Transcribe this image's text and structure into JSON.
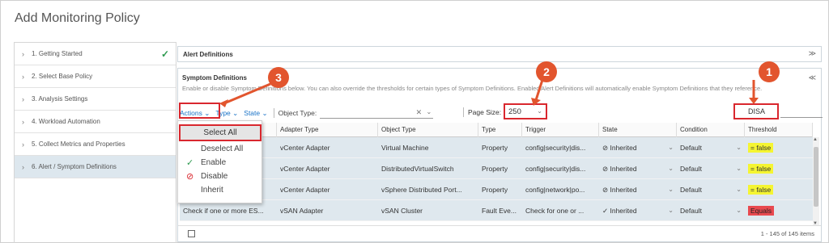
{
  "title": "Add Monitoring Policy",
  "steps": [
    {
      "label": "1. Getting Started"
    },
    {
      "label": "2. Select Base Policy"
    },
    {
      "label": "3. Analysis Settings"
    },
    {
      "label": "4. Workload Automation"
    },
    {
      "label": "5. Collect Metrics and Properties"
    },
    {
      "label": "6. Alert / Symptom Definitions"
    }
  ],
  "alert_definitions": {
    "title": "Alert Definitions"
  },
  "symptoms": {
    "title": "Symptom Definitions",
    "description": "Enable or disable Symptom Definitions below. You can also override the thresholds for certain types of Symptom Definitions. Enabled Alert Definitions will automatically enable Symptom Definitions that they reference."
  },
  "toolbar": {
    "actions": "Actions",
    "type": "Type",
    "state": "State",
    "object_type_label": "Object Type:",
    "page_size_label": "Page Size:",
    "page_size_value": "250",
    "search_value": "DISA"
  },
  "table": {
    "headers": [
      "",
      "Adapter Type",
      "Object Type",
      "Type",
      "Trigger",
      "State",
      "Condition",
      "Threshold"
    ],
    "rows": [
      {
        "name": "",
        "adapter": "vCenter Adapter",
        "object": "Virtual Machine",
        "type": "Property",
        "trigger": "config|security|dis...",
        "state": "Inherited",
        "condition": "Default",
        "threshold": "= false",
        "threshold_color": "#f5f532"
      },
      {
        "name": "",
        "adapter": "vCenter Adapter",
        "object": "DistributedVirtualSwitch",
        "type": "Property",
        "trigger": "config|security|dis...",
        "state": "Inherited",
        "condition": "Default",
        "threshold": "= false",
        "threshold_color": "#f5f532"
      },
      {
        "name": "",
        "adapter": "vCenter Adapter",
        "object": "vSphere Distributed Port...",
        "type": "Property",
        "trigger": "config|network|po...",
        "state": "Inherited",
        "condition": "Default",
        "threshold": "= false",
        "threshold_color": "#f5f532"
      },
      {
        "name": "Check if one or more ES...",
        "adapter": "vSAN Adapter",
        "object": "vSAN Cluster",
        "type": "Fault Eve...",
        "trigger": "Check for one or ...",
        "state": "Inherited",
        "condition": "Default",
        "threshold": "Equals",
        "threshold_color": "#e8494f"
      }
    ],
    "footer": "1 - 145 of 145 items"
  },
  "actions_menu": {
    "items": [
      "Select All",
      "Deselect All",
      "Enable",
      "Disable",
      "Inherit"
    ]
  },
  "callouts": [
    "1",
    "2",
    "3"
  ],
  "colors": {
    "callout": "#e2552e",
    "highlight_border": "#d9272e",
    "link": "#1a73c7",
    "row_bg": "#dfe8ee"
  }
}
